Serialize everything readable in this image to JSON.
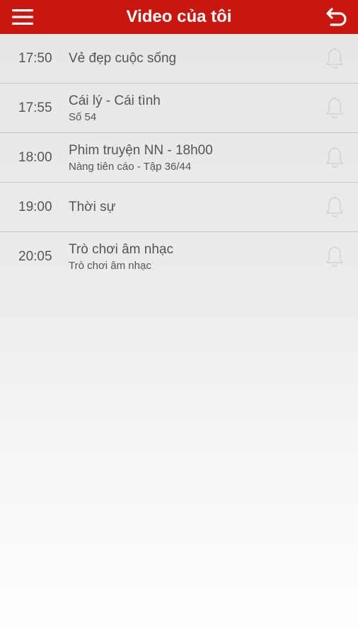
{
  "header": {
    "title": "Video của tôi",
    "menu_icon": "hamburger-menu-icon",
    "back_icon": "back-arrow-icon",
    "background_color": "#c8170e"
  },
  "schedule": [
    {
      "time": "17:50",
      "title": "Vẻ đẹp cuộc sống",
      "subtitle": ""
    },
    {
      "time": "17:55",
      "title": "Cái lý - Cái tình",
      "subtitle": "Số 54"
    },
    {
      "time": "18:00",
      "title": "Phim truyện NN - 18h00",
      "subtitle": "Nàng tiên cáo - Tập 36/44"
    },
    {
      "time": "19:00",
      "title": "Thời sự",
      "subtitle": ""
    },
    {
      "time": "20:05",
      "title": "Trò chơi âm nhạc",
      "subtitle": "Trò chơi âm nhạc"
    }
  ],
  "reminder_icon": "bell-icon"
}
